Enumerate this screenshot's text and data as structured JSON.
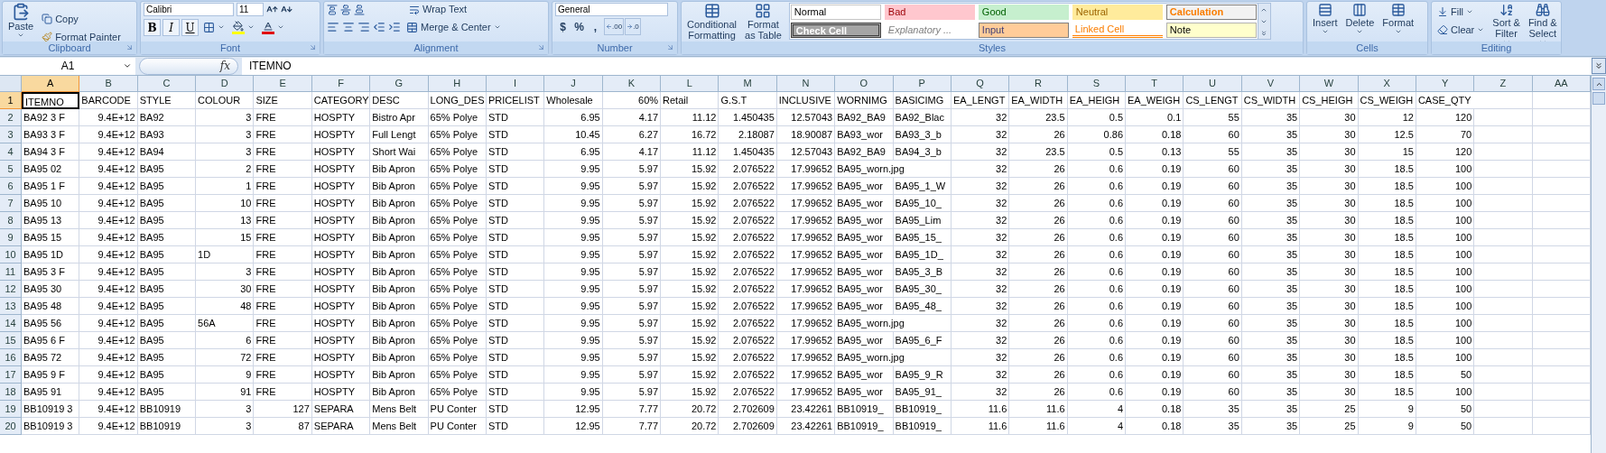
{
  "ribbon": {
    "groups": [
      {
        "kind": "clipboard",
        "label": "Clipboard",
        "paste": "Paste",
        "items": [
          "Copy",
          "Format Painter"
        ]
      },
      {
        "kind": "font",
        "label": "Font",
        "font_name": "Calibri",
        "font_size": "11",
        "buttons": [
          "B",
          "I",
          "U"
        ]
      },
      {
        "kind": "alignment",
        "label": "Alignment",
        "wrap": "Wrap Text",
        "merge": "Merge & Center"
      },
      {
        "kind": "number",
        "label": "Number",
        "format": "General",
        "buttons": [
          "$",
          "%",
          ","
        ],
        "decimals": [
          ".00",
          ".0"
        ]
      },
      {
        "kind": "styles",
        "label": "Styles",
        "commands": [
          {
            "lines": [
              "Conditional",
              "Formatting"
            ]
          },
          {
            "lines": [
              "Format",
              "as Table"
            ]
          }
        ],
        "cell_styles": [
          {
            "label": "Normal",
            "kind": "normal"
          },
          {
            "label": "Bad",
            "kind": "bad"
          },
          {
            "label": "Good",
            "kind": "good"
          },
          {
            "label": "Neutral",
            "kind": "neutral"
          },
          {
            "label": "Calculation",
            "kind": "calculation"
          },
          {
            "label": "Check Cell",
            "kind": "check"
          },
          {
            "label": "Explanatory ...",
            "kind": "explanatory"
          },
          {
            "label": "Input",
            "kind": "input"
          },
          {
            "label": "Linked Cell",
            "kind": "linked"
          },
          {
            "label": "Note",
            "kind": "note"
          }
        ]
      },
      {
        "kind": "cells",
        "label": "Cells",
        "commands": [
          {
            "lines": [
              "Insert"
            ]
          },
          {
            "lines": [
              "Delete"
            ]
          },
          {
            "lines": [
              "Format"
            ]
          }
        ]
      },
      {
        "kind": "editing",
        "label": "Editing",
        "small": [
          "Fill",
          "Clear"
        ],
        "commands": [
          {
            "lines": [
              "Sort &",
              "Filter"
            ]
          },
          {
            "lines": [
              "Find &",
              "Select"
            ]
          }
        ]
      }
    ]
  },
  "formula_bar": {
    "name_box": "A1",
    "function_label": "fx",
    "formula": "ITEMNO"
  },
  "sheet": {
    "columns": [
      {
        "label": "A",
        "selected": true
      },
      {
        "label": "B",
        "selected": false
      },
      {
        "label": "C",
        "selected": false
      },
      {
        "label": "D",
        "selected": false
      },
      {
        "label": "E",
        "selected": false
      },
      {
        "label": "F",
        "selected": false
      },
      {
        "label": "G",
        "selected": false
      },
      {
        "label": "H",
        "selected": false
      },
      {
        "label": "I",
        "selected": false
      },
      {
        "label": "J",
        "selected": false
      },
      {
        "label": "K",
        "selected": false
      },
      {
        "label": "L",
        "selected": false
      },
      {
        "label": "M",
        "selected": false
      },
      {
        "label": "N",
        "selected": false
      },
      {
        "label": "O",
        "selected": false
      },
      {
        "label": "P",
        "selected": false
      },
      {
        "label": "Q",
        "selected": false
      },
      {
        "label": "R",
        "selected": false
      },
      {
        "label": "S",
        "selected": false
      },
      {
        "label": "T",
        "selected": false
      },
      {
        "label": "U",
        "selected": false
      },
      {
        "label": "V",
        "selected": false
      },
      {
        "label": "W",
        "selected": false
      },
      {
        "label": "X",
        "selected": false
      },
      {
        "label": "Y",
        "selected": false
      },
      {
        "label": "Z",
        "selected": false
      },
      {
        "label": "AA",
        "selected": false
      }
    ],
    "rows": [
      {
        "number": "1",
        "selected": true,
        "cells": [
          "ITEMNO",
          "BARCODE",
          "STYLE",
          "COLOUR",
          "SIZE",
          "CATEGORY",
          "DESC",
          "LONG_DES",
          "PRICELIST",
          "Wholesale",
          "60%",
          "Retail",
          "G.S.T",
          "INCLUSIVE",
          "WORNIMG",
          "BASICIMG",
          "EA_LENGT",
          "EA_WIDTH",
          "EA_HEIGH",
          "EA_WEIGH",
          "CS_LENGT",
          "CS_WIDTH",
          "CS_HEIGH",
          "CS_WEIGH",
          "CASE_QTY"
        ]
      },
      {
        "number": "2",
        "selected": false,
        "cells": [
          "BA92  3 F",
          "9.4E+12",
          "BA92",
          "3",
          "FRE",
          "HOSPTY",
          "Bistro Apr",
          "65% Polye",
          "STD",
          "6.95",
          "4.17",
          "11.12",
          "1.450435",
          "12.57043",
          "BA92_BA9",
          "BA92_Blac",
          "32",
          "23.5",
          "0.5",
          "0.1",
          "55",
          "35",
          "30",
          "12",
          "120"
        ]
      },
      {
        "number": "3",
        "selected": false,
        "cells": [
          "BA93  3 F",
          "9.4E+12",
          "BA93",
          "3",
          "FRE",
          "HOSPTY",
          "Full Lengt",
          "65% Polye",
          "STD",
          "10.45",
          "6.27",
          "16.72",
          "2.18087",
          "18.90087",
          "BA93_wor",
          "BA93_3_b",
          "32",
          "26",
          "0.86",
          "0.18",
          "60",
          "35",
          "30",
          "12.5",
          "70"
        ]
      },
      {
        "number": "4",
        "selected": false,
        "cells": [
          "BA94  3 F",
          "9.4E+12",
          "BA94",
          "3",
          "FRE",
          "HOSPTY",
          "Short Wai",
          "65% Polye",
          "STD",
          "6.95",
          "4.17",
          "11.12",
          "1.450435",
          "12.57043",
          "BA92_BA9",
          "BA94_3_b",
          "32",
          "23.5",
          "0.5",
          "0.13",
          "55",
          "35",
          "30",
          "15",
          "120"
        ]
      },
      {
        "number": "5",
        "selected": false,
        "cells": [
          "BA95  02",
          "9.4E+12",
          "BA95",
          "2",
          "FRE",
          "HOSPTY",
          "Bib Apron",
          "65% Polye",
          "STD",
          "9.95",
          "5.97",
          "15.92",
          "2.076522",
          "17.99652",
          "BA95_worn.jpg",
          "",
          "32",
          "26",
          "0.6",
          "0.19",
          "60",
          "35",
          "30",
          "18.5",
          "100"
        ]
      },
      {
        "number": "6",
        "selected": false,
        "cells": [
          "BA95  1 F",
          "9.4E+12",
          "BA95",
          "1",
          "FRE",
          "HOSPTY",
          "Bib Apron",
          "65% Polye",
          "STD",
          "9.95",
          "5.97",
          "15.92",
          "2.076522",
          "17.99652",
          "BA95_wor",
          "BA95_1_W",
          "32",
          "26",
          "0.6",
          "0.19",
          "60",
          "35",
          "30",
          "18.5",
          "100"
        ]
      },
      {
        "number": "7",
        "selected": false,
        "cells": [
          "BA95  10",
          "9.4E+12",
          "BA95",
          "10",
          "FRE",
          "HOSPTY",
          "Bib Apron",
          "65% Polye",
          "STD",
          "9.95",
          "5.97",
          "15.92",
          "2.076522",
          "17.99652",
          "BA95_wor",
          "BA95_10_",
          "32",
          "26",
          "0.6",
          "0.19",
          "60",
          "35",
          "30",
          "18.5",
          "100"
        ]
      },
      {
        "number": "8",
        "selected": false,
        "cells": [
          "BA95  13",
          "9.4E+12",
          "BA95",
          "13",
          "FRE",
          "HOSPTY",
          "Bib Apron",
          "65% Polye",
          "STD",
          "9.95",
          "5.97",
          "15.92",
          "2.076522",
          "17.99652",
          "BA95_wor",
          "BA95_Lim",
          "32",
          "26",
          "0.6",
          "0.19",
          "60",
          "35",
          "30",
          "18.5",
          "100"
        ]
      },
      {
        "number": "9",
        "selected": false,
        "cells": [
          "BA95  15",
          "9.4E+12",
          "BA95",
          "15",
          "FRE",
          "HOSPTY",
          "Bib Apron",
          "65% Polye",
          "STD",
          "9.95",
          "5.97",
          "15.92",
          "2.076522",
          "17.99652",
          "BA95_wor",
          "BA95_15_",
          "32",
          "26",
          "0.6",
          "0.19",
          "60",
          "35",
          "30",
          "18.5",
          "100"
        ]
      },
      {
        "number": "10",
        "selected": false,
        "cells": [
          "BA95  1D",
          "9.4E+12",
          "BA95",
          "1D",
          "FRE",
          "HOSPTY",
          "Bib Apron",
          "65% Polye",
          "STD",
          "9.95",
          "5.97",
          "15.92",
          "2.076522",
          "17.99652",
          "BA95_wor",
          "BA95_1D_",
          "32",
          "26",
          "0.6",
          "0.19",
          "60",
          "35",
          "30",
          "18.5",
          "100"
        ]
      },
      {
        "number": "11",
        "selected": false,
        "cells": [
          "BA95  3 F",
          "9.4E+12",
          "BA95",
          "3",
          "FRE",
          "HOSPTY",
          "Bib Apron",
          "65% Polye",
          "STD",
          "9.95",
          "5.97",
          "15.92",
          "2.076522",
          "17.99652",
          "BA95_wor",
          "BA95_3_B",
          "32",
          "26",
          "0.6",
          "0.19",
          "60",
          "35",
          "30",
          "18.5",
          "100"
        ]
      },
      {
        "number": "12",
        "selected": false,
        "cells": [
          "BA95  30",
          "9.4E+12",
          "BA95",
          "30",
          "FRE",
          "HOSPTY",
          "Bib Apron",
          "65% Polye",
          "STD",
          "9.95",
          "5.97",
          "15.92",
          "2.076522",
          "17.99652",
          "BA95_wor",
          "BA95_30_",
          "32",
          "26",
          "0.6",
          "0.19",
          "60",
          "35",
          "30",
          "18.5",
          "100"
        ]
      },
      {
        "number": "13",
        "selected": false,
        "cells": [
          "BA95  48",
          "9.4E+12",
          "BA95",
          "48",
          "FRE",
          "HOSPTY",
          "Bib Apron",
          "65% Polye",
          "STD",
          "9.95",
          "5.97",
          "15.92",
          "2.076522",
          "17.99652",
          "BA95_wor",
          "BA95_48_",
          "32",
          "26",
          "0.6",
          "0.19",
          "60",
          "35",
          "30",
          "18.5",
          "100"
        ]
      },
      {
        "number": "14",
        "selected": false,
        "cells": [
          "BA95  56",
          "9.4E+12",
          "BA95",
          "56A",
          "FRE",
          "HOSPTY",
          "Bib Apron",
          "65% Polye",
          "STD",
          "9.95",
          "5.97",
          "15.92",
          "2.076522",
          "17.99652",
          "BA95_worn.jpg",
          "",
          "32",
          "26",
          "0.6",
          "0.19",
          "60",
          "35",
          "30",
          "18.5",
          "100"
        ]
      },
      {
        "number": "15",
        "selected": false,
        "cells": [
          "BA95  6 F",
          "9.4E+12",
          "BA95",
          "6",
          "FRE",
          "HOSPTY",
          "Bib Apron",
          "65% Polye",
          "STD",
          "9.95",
          "5.97",
          "15.92",
          "2.076522",
          "17.99652",
          "BA95_wor",
          "BA95_6_F",
          "32",
          "26",
          "0.6",
          "0.19",
          "60",
          "35",
          "30",
          "18.5",
          "100"
        ]
      },
      {
        "number": "16",
        "selected": false,
        "cells": [
          "BA95  72",
          "9.4E+12",
          "BA95",
          "72",
          "FRE",
          "HOSPTY",
          "Bib Apron",
          "65% Polye",
          "STD",
          "9.95",
          "5.97",
          "15.92",
          "2.076522",
          "17.99652",
          "BA95_worn.jpg",
          "",
          "32",
          "26",
          "0.6",
          "0.19",
          "60",
          "35",
          "30",
          "18.5",
          "100"
        ]
      },
      {
        "number": "17",
        "selected": false,
        "cells": [
          "BA95  9 F",
          "9.4E+12",
          "BA95",
          "9",
          "FRE",
          "HOSPTY",
          "Bib Apron",
          "65% Polye",
          "STD",
          "9.95",
          "5.97",
          "15.92",
          "2.076522",
          "17.99652",
          "BA95_wor",
          "BA95_9_R",
          "32",
          "26",
          "0.6",
          "0.19",
          "60",
          "35",
          "30",
          "18.5",
          "50"
        ]
      },
      {
        "number": "18",
        "selected": false,
        "cells": [
          "BA95  91",
          "9.4E+12",
          "BA95",
          "91",
          "FRE",
          "HOSPTY",
          "Bib Apron",
          "65% Polye",
          "STD",
          "9.95",
          "5.97",
          "15.92",
          "2.076522",
          "17.99652",
          "BA95_wor",
          "BA95_91_",
          "32",
          "26",
          "0.6",
          "0.19",
          "60",
          "35",
          "30",
          "18.5",
          "100"
        ]
      },
      {
        "number": "19",
        "selected": false,
        "cells": [
          "BB10919 3",
          "9.4E+12",
          "BB10919",
          "3",
          "127",
          "SEPARA",
          "Mens Belt",
          "PU Conter",
          "STD",
          "12.95",
          "7.77",
          "20.72",
          "2.702609",
          "23.42261",
          "BB10919_",
          "BB10919_",
          "11.6",
          "11.6",
          "4",
          "0.18",
          "35",
          "35",
          "25",
          "9",
          "50"
        ]
      },
      {
        "number": "20",
        "selected": false,
        "cells": [
          "BB10919 3",
          "9.4E+12",
          "BB10919",
          "3",
          "87",
          "SEPARA",
          "Mens Belt",
          "PU Conter",
          "STD",
          "12.95",
          "7.77",
          "20.72",
          "2.702609",
          "23.42261",
          "BB10919_",
          "BB10919_",
          "11.6",
          "11.6",
          "4",
          "0.18",
          "35",
          "35",
          "25",
          "9",
          "50"
        ]
      }
    ]
  }
}
